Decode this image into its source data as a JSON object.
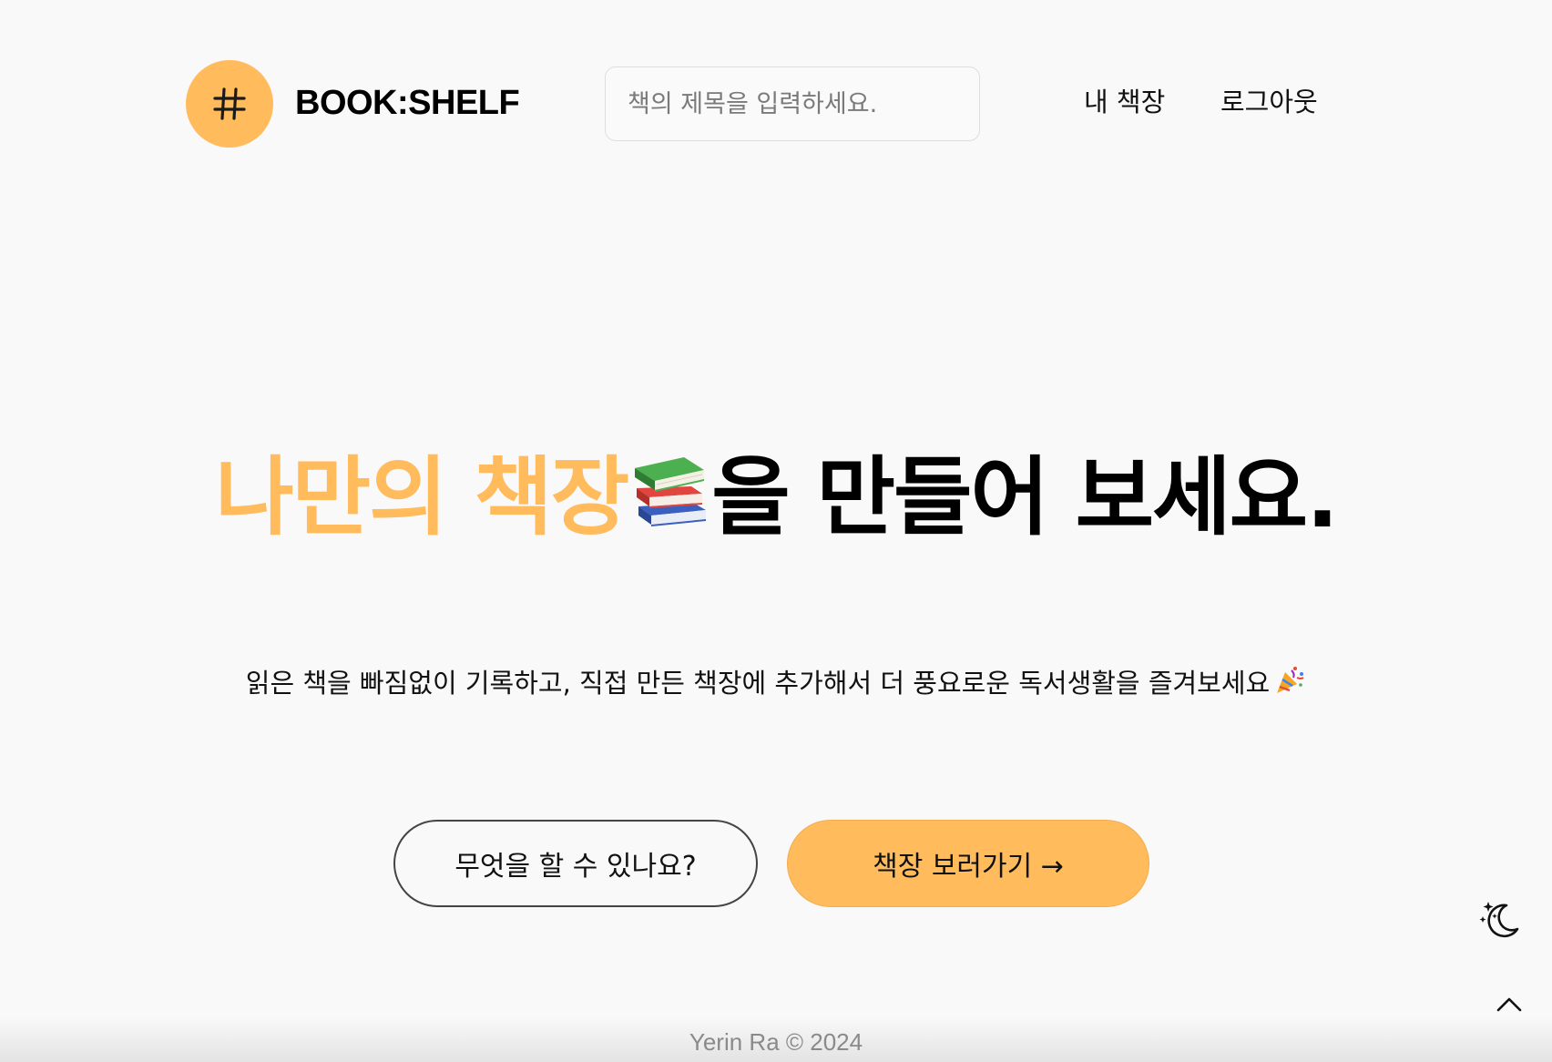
{
  "header": {
    "brand": "BOOK:SHELF",
    "logo_icon": "hash-icon",
    "search": {
      "placeholder": "책의 제목을 입력하세요.",
      "value": ""
    },
    "nav": [
      {
        "label": "내 책장"
      },
      {
        "label": "로그아웃"
      }
    ]
  },
  "hero": {
    "title_accent": "나만의 책장",
    "title_emoji": "books-icon",
    "title_rest": "을 만들어 보세요.",
    "subtitle": "읽은 책을 빠짐없이 기록하고, 직접 만든 책장에 추가해서 더 풍요로운 독서생활을 즐겨보세요",
    "subtitle_emoji": "party-popper-icon"
  },
  "buttons": {
    "secondary_label": "무엇을 할 수 있나요?",
    "primary_label": "책장 보러가기 →"
  },
  "floating": {
    "theme_toggle_icon": "moon-stars-icon",
    "scroll_top_icon": "chevron-up-icon"
  },
  "footer": {
    "text": "Yerin Ra © 2024"
  },
  "colors": {
    "accent": "#ffbb5c",
    "background": "#f9f9f9",
    "text": "#111111",
    "footer_text": "#8a8a8a"
  }
}
